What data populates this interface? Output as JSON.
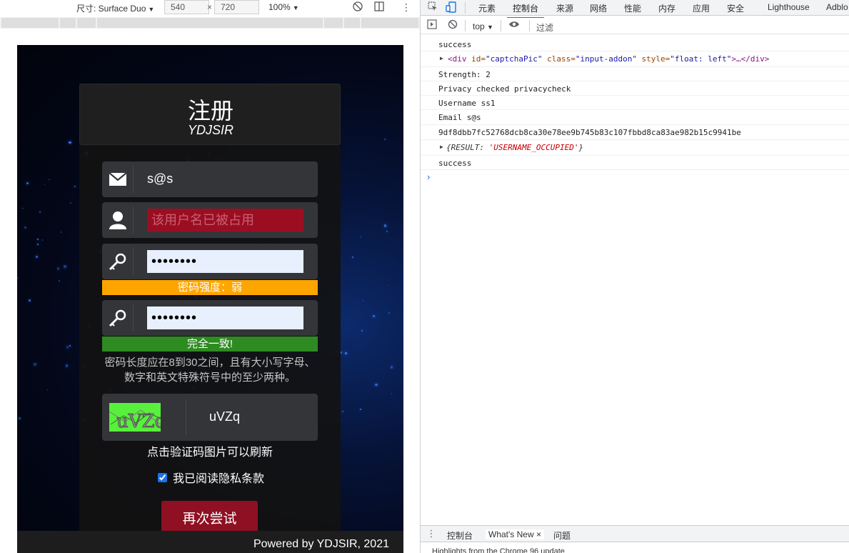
{
  "device_toolbar": {
    "dimensions_label": "尺寸: Surface Duo",
    "width": "540",
    "times": "×",
    "height": "720",
    "zoom": "100%"
  },
  "page": {
    "title": "注册",
    "subtitle": "YDJSIR",
    "email_value": "s@s",
    "username_placeholder": "该用户名已被占用",
    "password_value": "••••••••",
    "strength_text": "密码强度：弱",
    "confirm_value": "••••••••",
    "match_text": "完全一致!",
    "hint": "密码长度应在8到30之间，且有大小写字母、数字和英文特殊符号中的至少两种。",
    "captcha_text": "uVZq",
    "captcha_image_text": "uVZq",
    "refresh_tip": "点击验证码图片可以刷新",
    "privacy_label": "我已阅读隐私条款",
    "retry_button": "再次尝试",
    "footer": "Powered by YDJSIR, 2021"
  },
  "devtools": {
    "tabs": [
      "元素",
      "控制台",
      "来源",
      "网络",
      "性能",
      "内存",
      "应用",
      "安全",
      "Lighthouse",
      "Adblo"
    ],
    "context": "top",
    "filter": "过滤",
    "logs": [
      "success",
      "Strength: 2",
      "Privacy checked privacycheck",
      "Username ss1",
      "Email s@s",
      "9df8dbb7fc52768dcb8ca30e78ee9b745b83c107fbbd8ca83ae982b15c9941be",
      "success"
    ],
    "element_log": {
      "tag_open": "<div",
      "id_attr": " id=",
      "id_val": "\"captchaPic\"",
      "class_attr": " class=",
      "class_val": "\"input-addon\"",
      "style_attr": " style=",
      "style_val": "\"float: left\"",
      "tail": ">…</div>"
    },
    "object_log": {
      "open": "{RESULT: ",
      "value": "'USERNAME_OCCUPIED'",
      "close": "}"
    },
    "drawer_tabs": [
      "控制台",
      "What's New",
      "问题"
    ],
    "drawer_close": "×",
    "drawer_note": "Highlights from the Chrome 96 update"
  },
  "colors": {
    "error_field": "#9b0e22",
    "weak_bar": "#ffa500",
    "match_bar": "#2e8b22",
    "retry_button": "#8e1022",
    "devtools_accent": "#1a73e8"
  }
}
